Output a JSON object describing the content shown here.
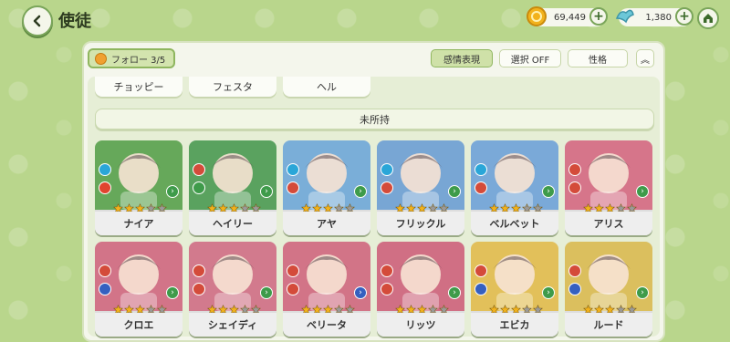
{
  "header": {
    "title": "使徒",
    "coins": "69,449",
    "gems": "1,380"
  },
  "toolbar": {
    "follow_label": "フォロー 3/5",
    "emotion_label": "感情表現",
    "select_label": "選択 OFF",
    "personality_label": "性格",
    "collapse_symbol": "︽"
  },
  "name_tabs": [
    "チョッピー",
    "フェスタ",
    "ヘル"
  ],
  "section": {
    "label": "未所持"
  },
  "cards": [
    {
      "name": "ナイア",
      "bg": "#66a85a",
      "stars": 3,
      "b1": "#2aa6d8",
      "b2": "#e0442f",
      "b3": "#3e9b4a"
    },
    {
      "name": "ヘイリー",
      "bg": "#5aa25f",
      "stars": 3,
      "b1": "#d44b3a",
      "b2": "#3e9b4a",
      "b3": "#3e9b4a"
    },
    {
      "name": "アヤ",
      "bg": "#7aaed8",
      "stars": 3,
      "b1": "#2aa6d8",
      "b2": "#d44b3a",
      "b3": "#3e9b4a"
    },
    {
      "name": "フリックル",
      "bg": "#78a6d4",
      "stars": 3,
      "b1": "#2aa6d8",
      "b2": "#d44b3a",
      "b3": "#3e9b4a"
    },
    {
      "name": "ベルベット",
      "bg": "#7aa9d8",
      "stars": 3,
      "b1": "#2aa6d8",
      "b2": "#d44b3a",
      "b3": "#3e9b4a"
    },
    {
      "name": "アリス",
      "bg": "#d6758a",
      "stars": 3,
      "b1": "#d44b3a",
      "b2": "#d44b3a",
      "b3": "#3e9b4a"
    },
    {
      "name": "クロエ",
      "bg": "#d27488",
      "stars": 3,
      "b1": "#d44b3a",
      "b2": "#3560c0",
      "b3": "#3e9b4a"
    },
    {
      "name": "シェイディ",
      "bg": "#d27a8d",
      "stars": 3,
      "b1": "#d44b3a",
      "b2": "#d44b3a",
      "b3": "#3e9b4a"
    },
    {
      "name": "ベリータ",
      "bg": "#d27487",
      "stars": 3,
      "b1": "#d44b3a",
      "b2": "#d44b3a",
      "b3": "#3560c0"
    },
    {
      "name": "リッツ",
      "bg": "#d06f84",
      "stars": 3,
      "b1": "#d44b3a",
      "b2": "#d44b3a",
      "b3": "#3e9b4a"
    },
    {
      "name": "エビカ",
      "bg": "#e2c05a",
      "stars": 3,
      "b1": "#d44b3a",
      "b2": "#3560c0",
      "b3": "#3e9b4a"
    },
    {
      "name": "ルード",
      "bg": "#dbbf5e",
      "stars": 3,
      "b1": "#d44b3a",
      "b2": "#3560c0",
      "b3": "#3e9b4a"
    }
  ]
}
